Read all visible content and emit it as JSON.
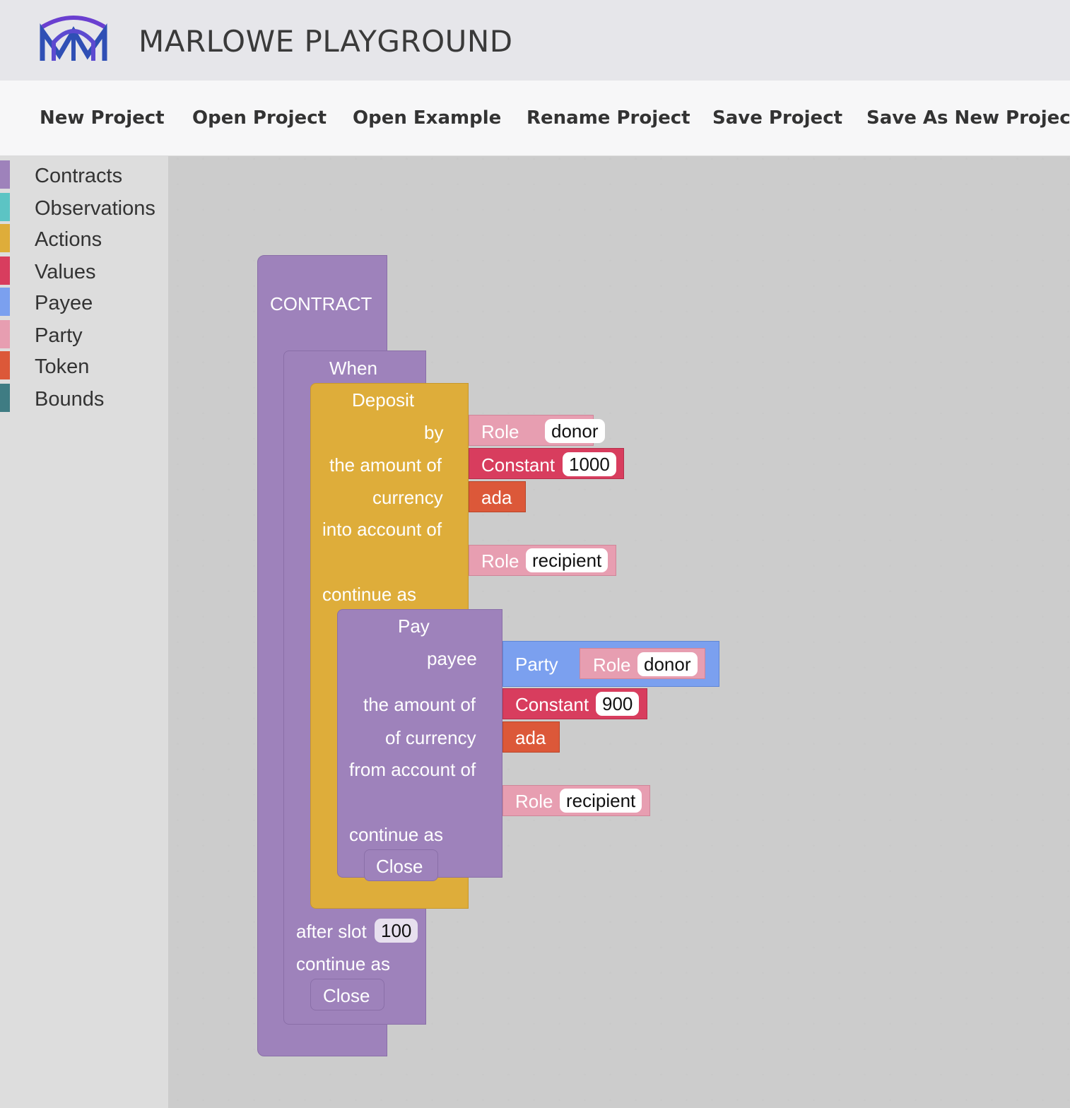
{
  "header": {
    "title": "MARLOWE PLAYGROUND",
    "logo_icon": "marlowe-logo-icon",
    "logo_colors": [
      "#6a3fd0",
      "#2f4fb5"
    ]
  },
  "menu": {
    "items": [
      {
        "label": "New Project"
      },
      {
        "label": "Open Project"
      },
      {
        "label": "Open Example"
      },
      {
        "label": "Rename Project"
      },
      {
        "label": "Save Project"
      },
      {
        "label": "Save As New Project"
      }
    ]
  },
  "sidebar": {
    "categories": [
      {
        "label": "Contracts",
        "color": "#9e82bb"
      },
      {
        "label": "Observations",
        "color": "#5cc4c4"
      },
      {
        "label": "Actions",
        "color": "#dead3a"
      },
      {
        "label": "Values",
        "color": "#d83d5e"
      },
      {
        "label": "Payee",
        "color": "#7ba0ef"
      },
      {
        "label": "Party",
        "color": "#e79eb1"
      },
      {
        "label": "Token",
        "color": "#dc5839"
      },
      {
        "label": "Bounds",
        "color": "#3f7c83"
      }
    ]
  },
  "blocks": {
    "contract": {
      "label": "CONTRACT"
    },
    "when": {
      "label": "When",
      "after_slot_label": "after slot",
      "after_slot_value": "100",
      "continue_label": "continue as",
      "close_label": "Close"
    },
    "deposit": {
      "label": "Deposit",
      "by_label": "by",
      "amount_label": "the amount of",
      "currency_label": "currency",
      "into_label": "into account of",
      "continue_label": "continue as",
      "by_role_label": "Role",
      "by_role_value": "donor",
      "constant_label": "Constant",
      "constant_value": "1000",
      "token_label": "ada",
      "into_role_label": "Role",
      "into_role_value": "recipient"
    },
    "pay": {
      "label": "Pay",
      "payee_label": "payee",
      "amount_label": "the amount of",
      "currency_label": "of currency",
      "from_label": "from account of",
      "continue_label": "continue as",
      "party_label": "Party",
      "party_role_label": "Role",
      "party_role_value": "donor",
      "constant_label": "Constant",
      "constant_value": "900",
      "token_label": "ada",
      "from_role_label": "Role",
      "from_role_value": "recipient",
      "close_label": "Close"
    }
  }
}
